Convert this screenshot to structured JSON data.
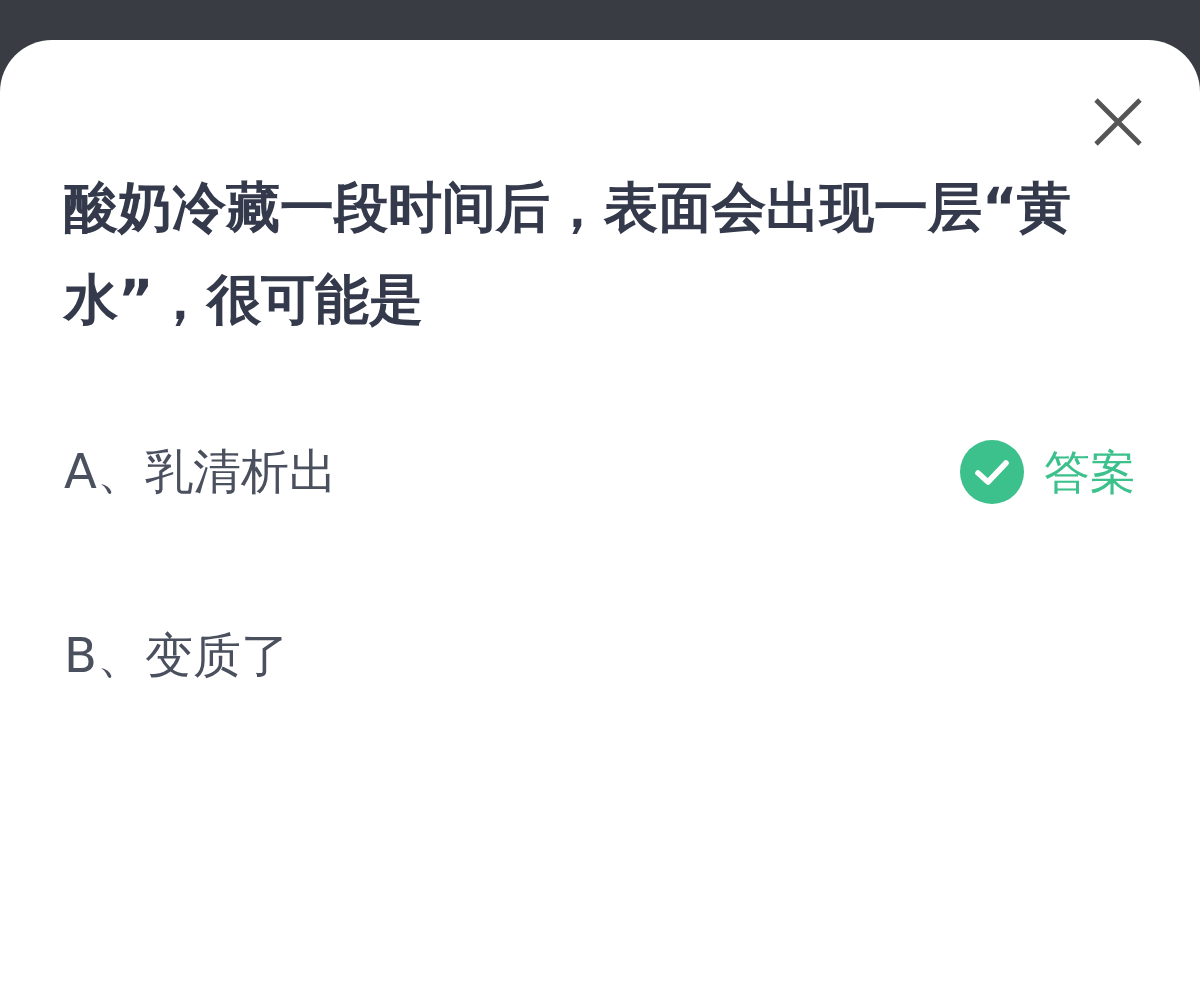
{
  "question": "酸奶冷藏一段时间后，表面会出现一层“黄水”，很可能是",
  "answer_label": "答案",
  "options": [
    {
      "text": "A、乳清析出",
      "correct": true
    },
    {
      "text": "B、变质了",
      "correct": false
    }
  ]
}
